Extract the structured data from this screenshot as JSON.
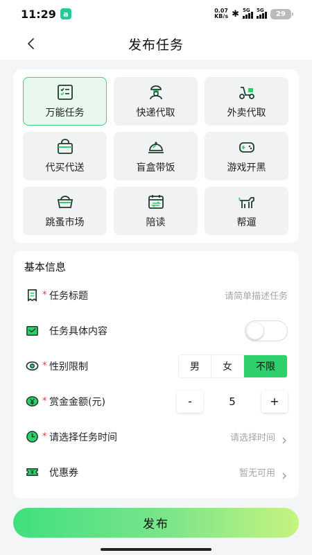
{
  "status_bar": {
    "time": "11:29",
    "app_badge": "a",
    "net_speed_value": "0.07",
    "net_speed_unit": "KB/s",
    "bluetooth_icon": "bluetooth-icon",
    "sim1_label": "5G",
    "sim2_label": "5G",
    "battery": "29"
  },
  "nav": {
    "title": "发布任务",
    "back_icon": "chevron-left-icon"
  },
  "categories": [
    {
      "label": "万能任务",
      "icon": "checklist-icon",
      "selected": true
    },
    {
      "label": "快递代取",
      "icon": "courier-icon",
      "selected": false
    },
    {
      "label": "外卖代取",
      "icon": "scooter-icon",
      "selected": false
    },
    {
      "label": "代买代送",
      "icon": "shopping-basket-icon",
      "selected": false
    },
    {
      "label": "盲盒带饭",
      "icon": "food-cloche-icon",
      "selected": false
    },
    {
      "label": "游戏开黑",
      "icon": "gamepad-icon",
      "selected": false
    },
    {
      "label": "跳蚤市场",
      "icon": "market-basket-icon",
      "selected": false
    },
    {
      "label": "陪读",
      "icon": "calendar-icon",
      "selected": false
    },
    {
      "label": "帮遛",
      "icon": "dog-icon",
      "selected": false
    }
  ],
  "basic_info": {
    "title": "基本信息",
    "task_title": {
      "label": "任务标题",
      "required": "*",
      "placeholder": "请简单描述任务",
      "icon": "receipt-icon"
    },
    "task_content": {
      "label": "任务具体内容",
      "toggle_on": false,
      "icon": "envelope-icon"
    },
    "gender": {
      "label": "性别限制",
      "required": "*",
      "options": [
        "男",
        "女",
        "不限"
      ],
      "selected": "不限",
      "icon": "eye-icon"
    },
    "reward": {
      "label": "赏金金额(元)",
      "required": "*",
      "minus": "-",
      "value": "5",
      "plus": "+",
      "icon": "yen-coin-icon"
    },
    "time": {
      "label": "请选择任务时间",
      "required": "*",
      "placeholder": "请选择时间",
      "icon": "clock-icon"
    },
    "coupon": {
      "label": "优惠券",
      "placeholder": "暂无可用",
      "icon": "ticket-icon"
    }
  },
  "submit_label": "发布",
  "colors": {
    "accent": "#2ed06b",
    "selected_tile_bg": "#e8f8ee",
    "icon_dark": "#1f3b2c",
    "required": "#e23b3b"
  }
}
